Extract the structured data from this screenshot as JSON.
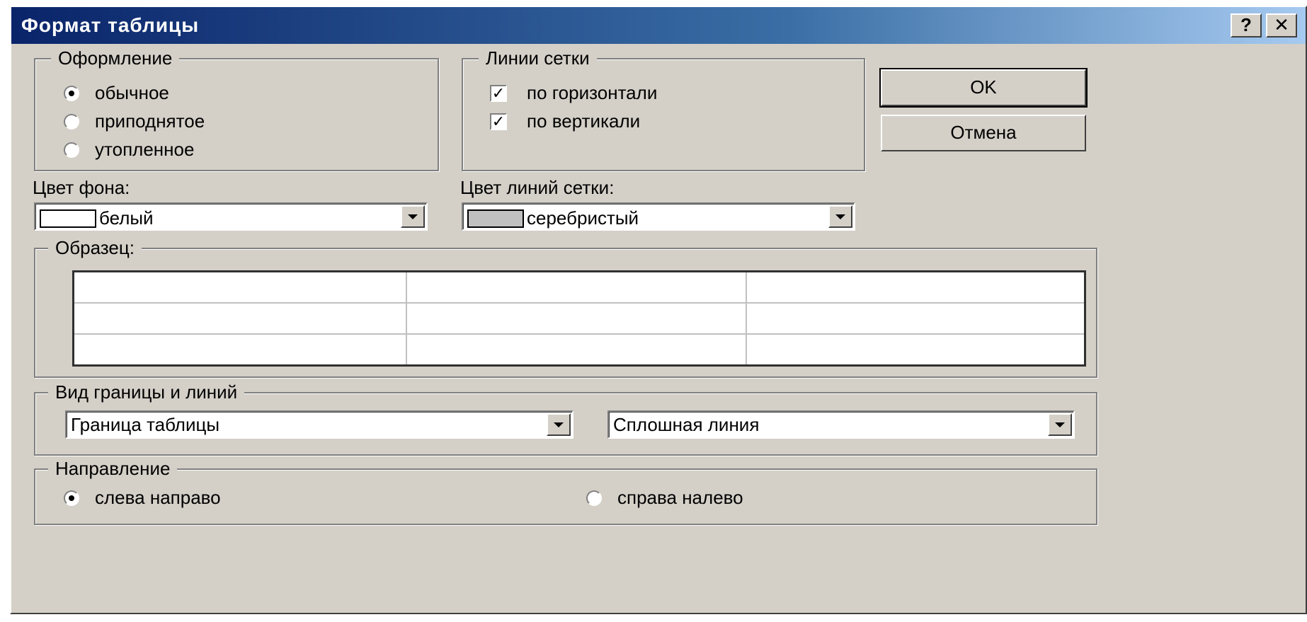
{
  "window": {
    "title": "Формат таблицы",
    "help_label": "?",
    "close_label": "✕"
  },
  "appearance": {
    "legend": "Оформление",
    "options": [
      {
        "label": "обычное",
        "selected": true
      },
      {
        "label": "приподнятое",
        "selected": false
      },
      {
        "label": "утопленное",
        "selected": false
      }
    ]
  },
  "gridlines": {
    "legend": "Линии сетки",
    "horizontal": {
      "label": "по горизонтали",
      "checked": true
    },
    "vertical": {
      "label": "по вертикали",
      "checked": true
    }
  },
  "buttons": {
    "ok": "OK",
    "cancel": "Отмена"
  },
  "background_color": {
    "label": "Цвет фона:",
    "value": "белый",
    "swatch": "#ffffff"
  },
  "gridline_color": {
    "label": "Цвет линий сетки:",
    "value": "серебристый",
    "swatch": "#c0c0c0"
  },
  "sample": {
    "legend": "Образец:",
    "rows": 3,
    "columns": 3
  },
  "border_style": {
    "legend": "Вид границы и линий",
    "element_value": "Граница таблицы",
    "line_value": "Сплошная линия"
  },
  "direction": {
    "legend": "Направление",
    "left_to_right": {
      "label": "слева направо",
      "selected": true
    },
    "right_to_left": {
      "label": "справа налево",
      "selected": false
    }
  }
}
